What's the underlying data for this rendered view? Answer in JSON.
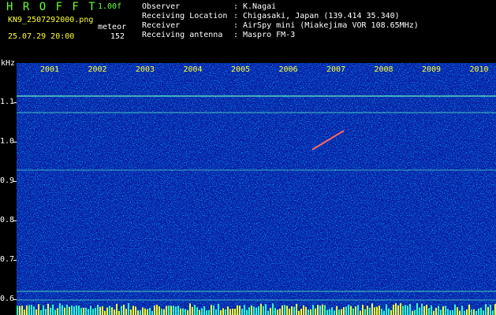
{
  "header": {
    "logo": "H R O F F T",
    "version": "1.00f",
    "filename": "KN9_2507292000.png",
    "mode_label": "meteor",
    "datetime": "25.07.29 20:00",
    "count": "152"
  },
  "meta": [
    {
      "key": "Observer",
      "value": "K.Nagai"
    },
    {
      "key": "Receiving Location",
      "value": "Chigasaki, Japan (139.414 35.340)"
    },
    {
      "key": "Receiver",
      "value": "AirSpy mini (Miakejima VOR 108.65MHz)"
    },
    {
      "key": "Receiving antenna",
      "value": "Maspro FM-3"
    }
  ],
  "meta_separator": ":",
  "axis": {
    "y_unit": "kHz",
    "y_ticks": [
      "1.1",
      "1.0",
      "0.9",
      "0.8",
      "0.7",
      "0.6"
    ],
    "x_ticks": [
      "2001",
      "2002",
      "2003",
      "2004",
      "2005",
      "2006",
      "2007",
      "2008",
      "2009",
      "2010"
    ]
  },
  "colors": {
    "background": "#000000",
    "noise_base": "#0a1aa0",
    "signal_line": "#66ffcc",
    "meteor": "#ff6666",
    "label_green": "#66ff33",
    "label_yellow": "#ffff33"
  }
}
